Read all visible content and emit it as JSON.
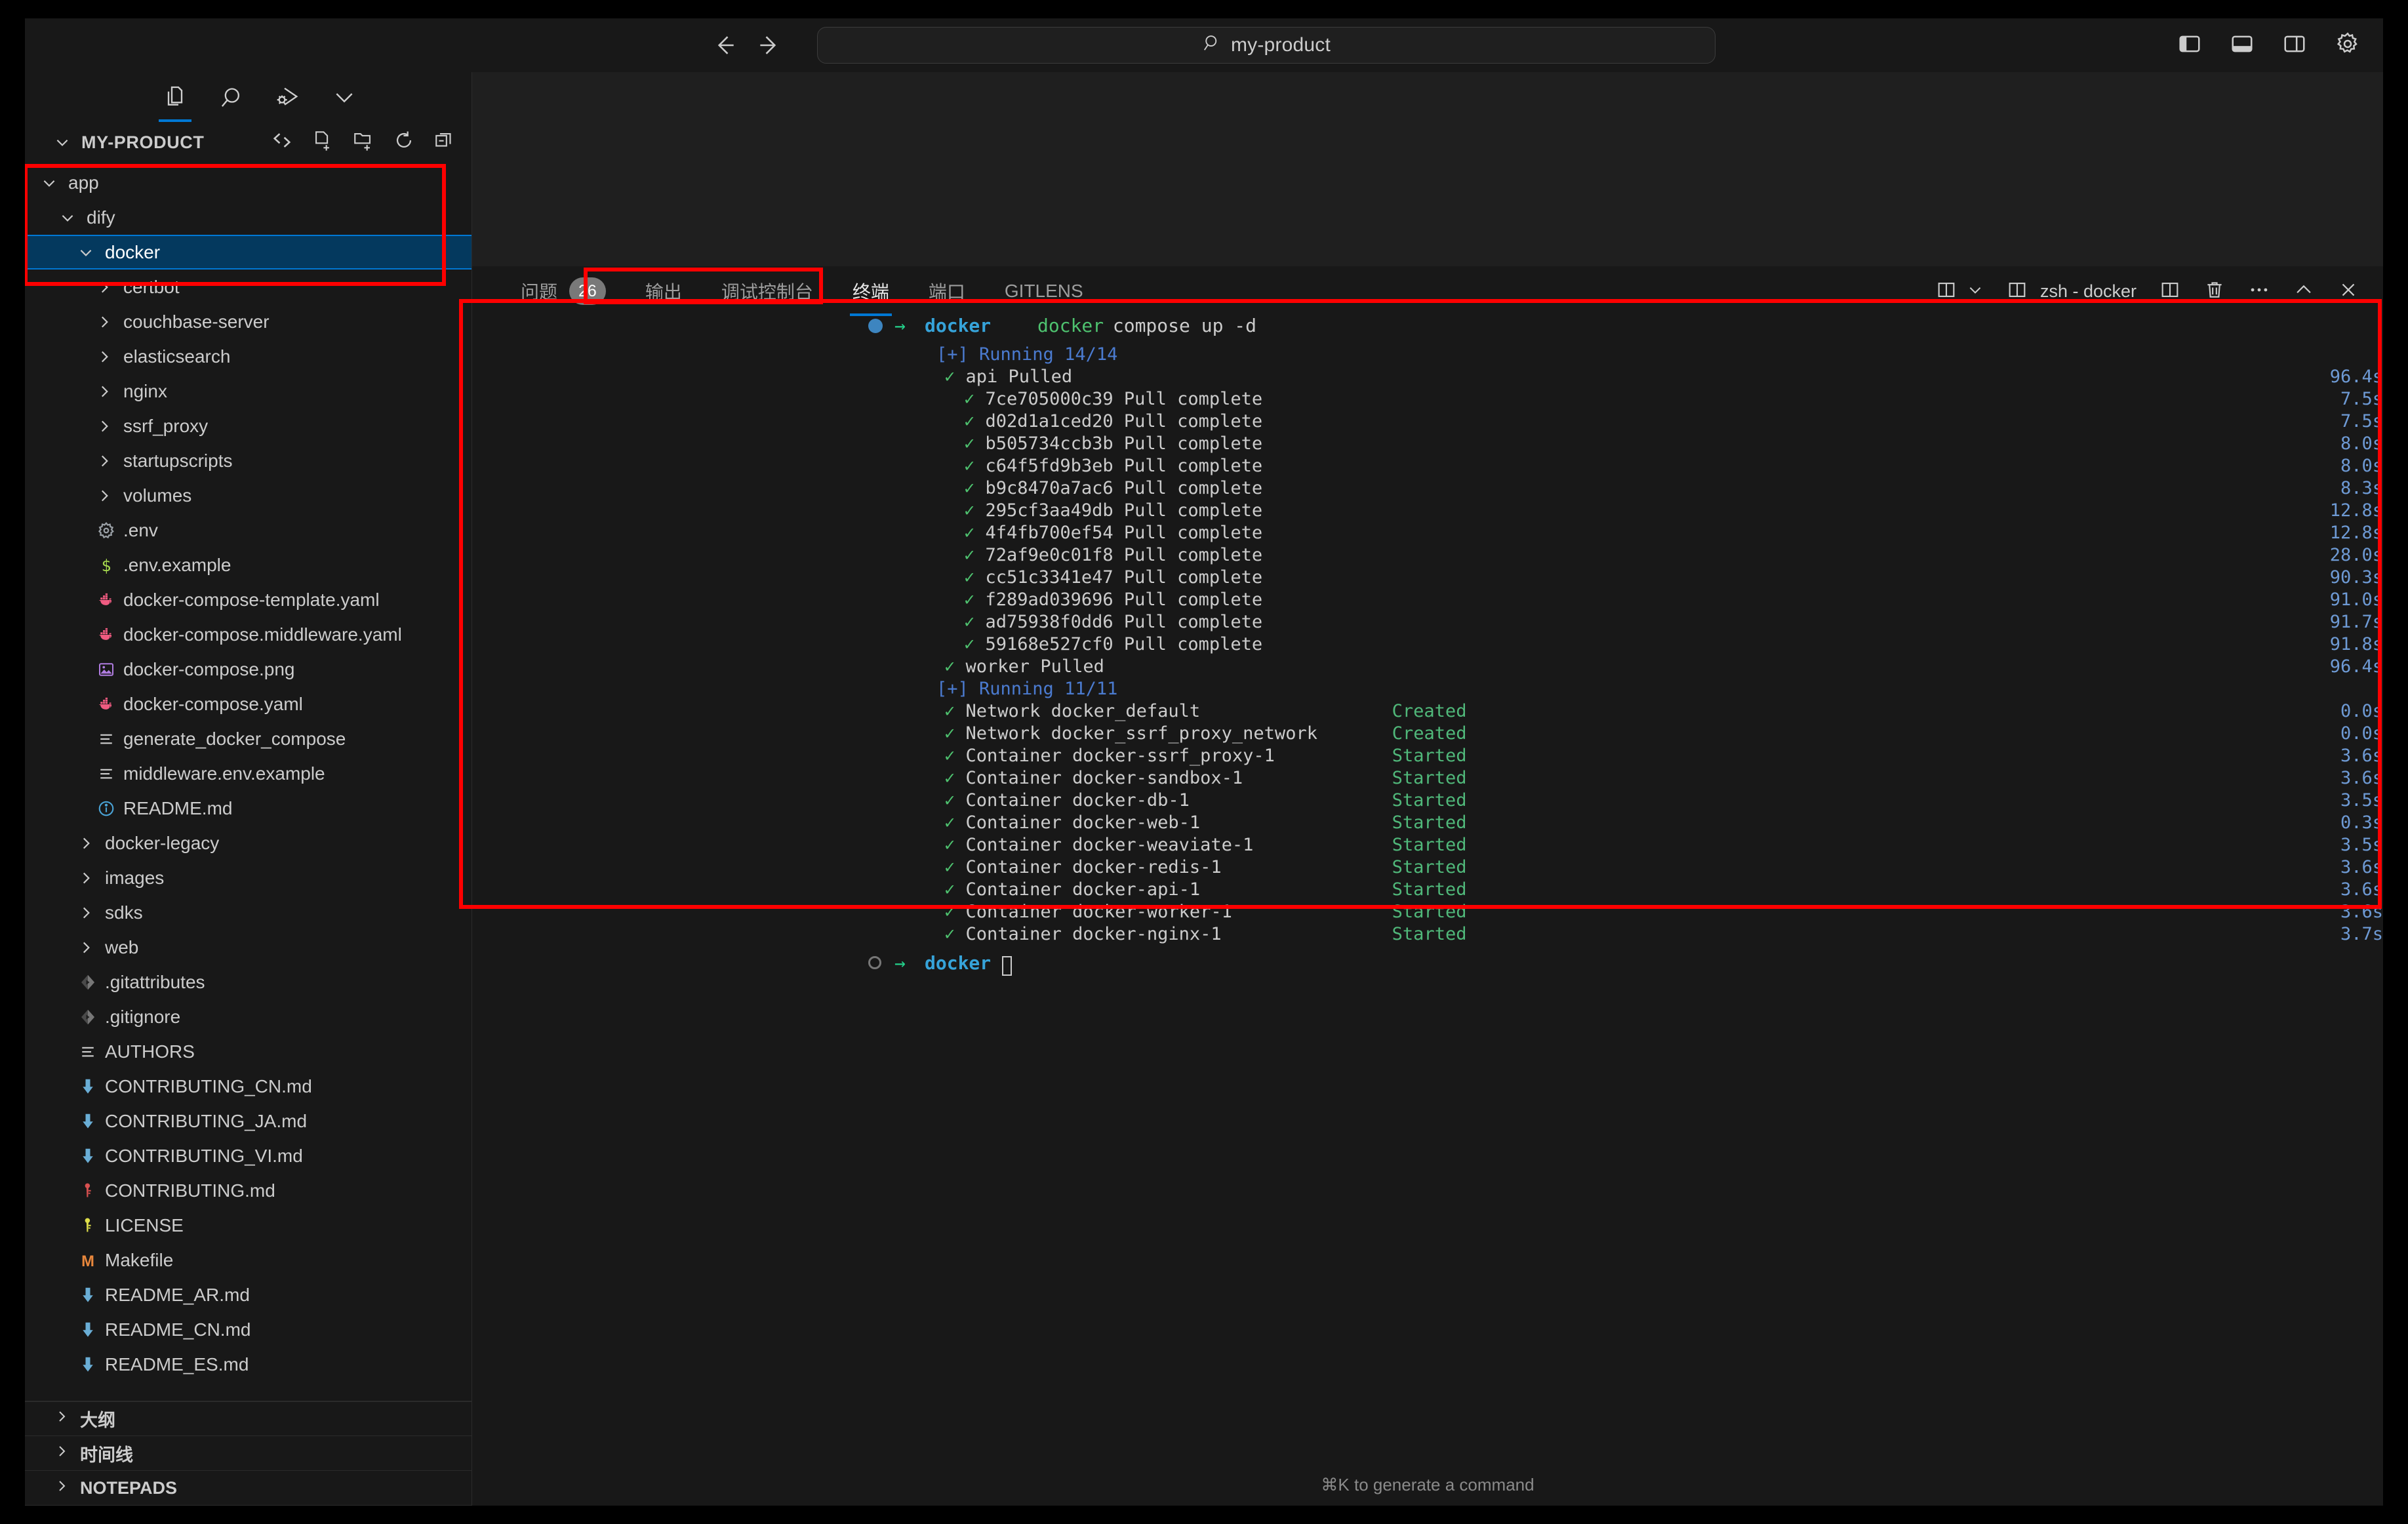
{
  "titlebar": {
    "back_icon": "arrow-left-icon",
    "forward_icon": "arrow-right-icon",
    "search_value": "my-product",
    "search_icon": "search-icon",
    "right_icons": [
      "toggle-primary-sidebar-icon",
      "toggle-panel-icon",
      "toggle-secondary-sidebar-icon",
      "gear-icon"
    ]
  },
  "sidebar": {
    "tabs": [
      {
        "name": "explorer-icon",
        "active": true
      },
      {
        "name": "search-icon",
        "active": false
      },
      {
        "name": "run-and-debug-icon",
        "active": false
      },
      {
        "name": "chevron-down-icon",
        "active": false
      }
    ],
    "explorer": {
      "title": "MY-PRODUCT",
      "actions": [
        "source-control-icon",
        "new-file-icon",
        "new-folder-icon",
        "refresh-icon",
        "collapse-all-icon"
      ]
    },
    "tree": [
      {
        "label": "app",
        "type": "folder",
        "expanded": true,
        "indent": 0,
        "selected": false
      },
      {
        "label": "dify",
        "type": "folder",
        "expanded": true,
        "indent": 1,
        "selected": false
      },
      {
        "label": "docker",
        "type": "folder",
        "expanded": true,
        "indent": 2,
        "selected": true
      },
      {
        "label": "certbot",
        "type": "folder",
        "expanded": false,
        "indent": 3,
        "selected": false
      },
      {
        "label": "couchbase-server",
        "type": "folder",
        "expanded": false,
        "indent": 3,
        "selected": false
      },
      {
        "label": "elasticsearch",
        "type": "folder",
        "expanded": false,
        "indent": 3,
        "selected": false
      },
      {
        "label": "nginx",
        "type": "folder",
        "expanded": false,
        "indent": 3,
        "selected": false
      },
      {
        "label": "ssrf_proxy",
        "type": "folder",
        "expanded": false,
        "indent": 3,
        "selected": false
      },
      {
        "label": "startupscripts",
        "type": "folder",
        "expanded": false,
        "indent": 3,
        "selected": false
      },
      {
        "label": "volumes",
        "type": "folder",
        "expanded": false,
        "indent": 3,
        "selected": false
      },
      {
        "label": ".env",
        "type": "file",
        "icon": "gear-file-icon",
        "indent": 3,
        "selected": false
      },
      {
        "label": ".env.example",
        "type": "file",
        "icon": "shell-file-icon",
        "indent": 3,
        "selected": false
      },
      {
        "label": "docker-compose-template.yaml",
        "type": "file",
        "icon": "docker-file-icon",
        "indent": 3,
        "selected": false
      },
      {
        "label": "docker-compose.middleware.yaml",
        "type": "file",
        "icon": "docker-file-icon",
        "indent": 3,
        "selected": false
      },
      {
        "label": "docker-compose.png",
        "type": "file",
        "icon": "image-file-icon",
        "indent": 3,
        "selected": false
      },
      {
        "label": "docker-compose.yaml",
        "type": "file",
        "icon": "docker-file-icon",
        "indent": 3,
        "selected": false
      },
      {
        "label": "generate_docker_compose",
        "type": "file",
        "icon": "text-file-icon",
        "indent": 3,
        "selected": false
      },
      {
        "label": "middleware.env.example",
        "type": "file",
        "icon": "text-file-icon",
        "indent": 3,
        "selected": false
      },
      {
        "label": "README.md",
        "type": "file",
        "icon": "info-file-icon",
        "indent": 3,
        "selected": false
      },
      {
        "label": "docker-legacy",
        "type": "folder",
        "expanded": false,
        "indent": 2,
        "selected": false
      },
      {
        "label": "images",
        "type": "folder",
        "expanded": false,
        "indent": 2,
        "selected": false
      },
      {
        "label": "sdks",
        "type": "folder",
        "expanded": false,
        "indent": 2,
        "selected": false
      },
      {
        "label": "web",
        "type": "folder",
        "expanded": false,
        "indent": 2,
        "selected": false
      },
      {
        "label": ".gitattributes",
        "type": "file",
        "icon": "git-file-icon",
        "indent": 2,
        "selected": false
      },
      {
        "label": ".gitignore",
        "type": "file",
        "icon": "git-file-icon",
        "indent": 2,
        "selected": false
      },
      {
        "label": "AUTHORS",
        "type": "file",
        "icon": "text-file-icon",
        "indent": 2,
        "selected": false
      },
      {
        "label": "CONTRIBUTING_CN.md",
        "type": "file",
        "icon": "markdown-file-icon",
        "indent": 2,
        "selected": false
      },
      {
        "label": "CONTRIBUTING_JA.md",
        "type": "file",
        "icon": "markdown-file-icon",
        "indent": 2,
        "selected": false
      },
      {
        "label": "CONTRIBUTING_VI.md",
        "type": "file",
        "icon": "markdown-file-icon",
        "indent": 2,
        "selected": false
      },
      {
        "label": "CONTRIBUTING.md",
        "type": "file",
        "icon": "key-red-file-icon",
        "indent": 2,
        "selected": false
      },
      {
        "label": "LICENSE",
        "type": "file",
        "icon": "key-yellow-file-icon",
        "indent": 2,
        "selected": false
      },
      {
        "label": "Makefile",
        "type": "file",
        "icon": "makefile-icon",
        "indent": 2,
        "selected": false
      },
      {
        "label": "README_AR.md",
        "type": "file",
        "icon": "markdown-file-icon",
        "indent": 2,
        "selected": false
      },
      {
        "label": "README_CN.md",
        "type": "file",
        "icon": "markdown-file-icon",
        "indent": 2,
        "selected": false
      },
      {
        "label": "README_ES.md",
        "type": "file",
        "icon": "markdown-file-icon",
        "indent": 2,
        "selected": false
      }
    ],
    "sections": [
      {
        "label": "大纲"
      },
      {
        "label": "时间线"
      },
      {
        "label": "NOTEPADS"
      }
    ]
  },
  "panel": {
    "tabs": [
      {
        "label": "问题",
        "badge": "26",
        "active": false
      },
      {
        "label": "输出",
        "badge": "",
        "active": false
      },
      {
        "label": "调试控制台",
        "badge": "",
        "active": false
      },
      {
        "label": "终端",
        "badge": "",
        "active": true
      },
      {
        "label": "端口",
        "badge": "",
        "active": false
      },
      {
        "label": "GITLENS",
        "badge": "",
        "active": false
      }
    ],
    "actions": {
      "split_dropdown_icon": "split-terminal-dropdown-icon",
      "chevron_icon": "chevron-down-icon",
      "terminal_icon": "terminal-tab-icon",
      "terminal_name": "zsh - docker",
      "split_icon": "split-editor-icon",
      "kill_icon": "trash-icon",
      "more_icon": "more-actions-icon",
      "maximize_icon": "chevron-up-icon",
      "close_icon": "close-icon"
    }
  },
  "terminal": {
    "prompt": {
      "status_icon": "status-dot-icon",
      "arrow": "→",
      "cwd": "docker",
      "command_cmd": "docker",
      "command_args": " compose up -d"
    },
    "lines": [
      {
        "kind": "header",
        "text": "[+] Running 14/14",
        "dur": ""
      },
      {
        "kind": "ok1",
        "text": "api Pulled",
        "dur": "96.4s"
      },
      {
        "kind": "ok2",
        "text": "7ce705000c39 Pull complete",
        "dur": "7.5s"
      },
      {
        "kind": "ok2",
        "text": "d02d1a1ced20 Pull complete",
        "dur": "7.5s"
      },
      {
        "kind": "ok2",
        "text": "b505734ccb3b Pull complete",
        "dur": "8.0s"
      },
      {
        "kind": "ok2",
        "text": "c64f5fd9b3eb Pull complete",
        "dur": "8.0s"
      },
      {
        "kind": "ok2",
        "text": "b9c8470a7ac6 Pull complete",
        "dur": "8.3s"
      },
      {
        "kind": "ok2",
        "text": "295cf3aa49db Pull complete",
        "dur": "12.8s"
      },
      {
        "kind": "ok2",
        "text": "4f4fb700ef54 Pull complete",
        "dur": "12.8s"
      },
      {
        "kind": "ok2",
        "text": "72af9e0c01f8 Pull complete",
        "dur": "28.0s"
      },
      {
        "kind": "ok2",
        "text": "cc51c3341e47 Pull complete",
        "dur": "90.3s"
      },
      {
        "kind": "ok2",
        "text": "f289ad039696 Pull complete",
        "dur": "91.0s"
      },
      {
        "kind": "ok2",
        "text": "ad75938f0dd6 Pull complete",
        "dur": "91.7s"
      },
      {
        "kind": "ok2",
        "text": "59168e527cf0 Pull complete",
        "dur": "91.8s"
      },
      {
        "kind": "ok1",
        "text": "worker Pulled",
        "dur": "96.4s"
      },
      {
        "kind": "header",
        "text": "[+] Running 11/11",
        "dur": ""
      },
      {
        "kind": "res",
        "text": "Network docker_default",
        "status": "Created",
        "dur": "0.0s"
      },
      {
        "kind": "res",
        "text": "Network docker_ssrf_proxy_network",
        "status": "Created",
        "dur": "0.0s"
      },
      {
        "kind": "res",
        "text": "Container docker-ssrf_proxy-1",
        "status": "Started",
        "dur": "3.6s"
      },
      {
        "kind": "res",
        "text": "Container docker-sandbox-1",
        "status": "Started",
        "dur": "3.6s"
      },
      {
        "kind": "res",
        "text": "Container docker-db-1",
        "status": "Started",
        "dur": "3.5s"
      },
      {
        "kind": "res",
        "text": "Container docker-web-1",
        "status": "Started",
        "dur": "0.3s"
      },
      {
        "kind": "res",
        "text": "Container docker-weaviate-1",
        "status": "Started",
        "dur": "3.5s"
      },
      {
        "kind": "res",
        "text": "Container docker-redis-1",
        "status": "Started",
        "dur": "3.6s"
      },
      {
        "kind": "res",
        "text": "Container docker-api-1",
        "status": "Started",
        "dur": "3.6s"
      },
      {
        "kind": "res",
        "text": "Container docker-worker-1",
        "status": "Started",
        "dur": "3.6s"
      },
      {
        "kind": "res",
        "text": "Container docker-nginx-1",
        "status": "Started",
        "dur": "3.7s"
      }
    ],
    "final_prompt": {
      "status_icon": "status-circle-icon",
      "arrow": "→",
      "cwd": "docker"
    },
    "hint": "⌘K to generate a command"
  },
  "colors": {
    "accent": "#0078d4",
    "selection": "#04395e",
    "annotation": "#ff0000",
    "terminal_blue": "#4b7bd0",
    "terminal_green": "#4ec26f",
    "duration": "#6e9ad4"
  }
}
